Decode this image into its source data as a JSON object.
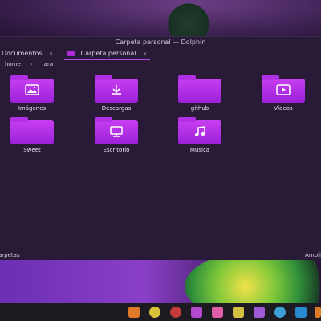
{
  "window": {
    "title": "Carpeta personal — Dolphin"
  },
  "tabs": [
    {
      "label": "Documentos"
    },
    {
      "label": "Carpeta personal"
    }
  ],
  "breadcrumb": [
    "home",
    "lara"
  ],
  "items": [
    {
      "label": "Imágenes",
      "icon": "image-icon"
    },
    {
      "label": "Descargas",
      "icon": "download-icon"
    },
    {
      "label": "github",
      "icon": "folder-icon"
    },
    {
      "label": "Vídeos",
      "icon": "video-icon"
    },
    {
      "label": "Sweet",
      "icon": "folder-icon"
    },
    {
      "label": "Escritorio",
      "icon": "desktop-icon"
    },
    {
      "label": "Música",
      "icon": "music-icon"
    }
  ],
  "status": {
    "left": "arpetas",
    "right": "Ampli"
  },
  "colors": {
    "accent": "#b02ad8",
    "window_bg": "#291a37",
    "taskbar_bg": "#1e1a22"
  }
}
